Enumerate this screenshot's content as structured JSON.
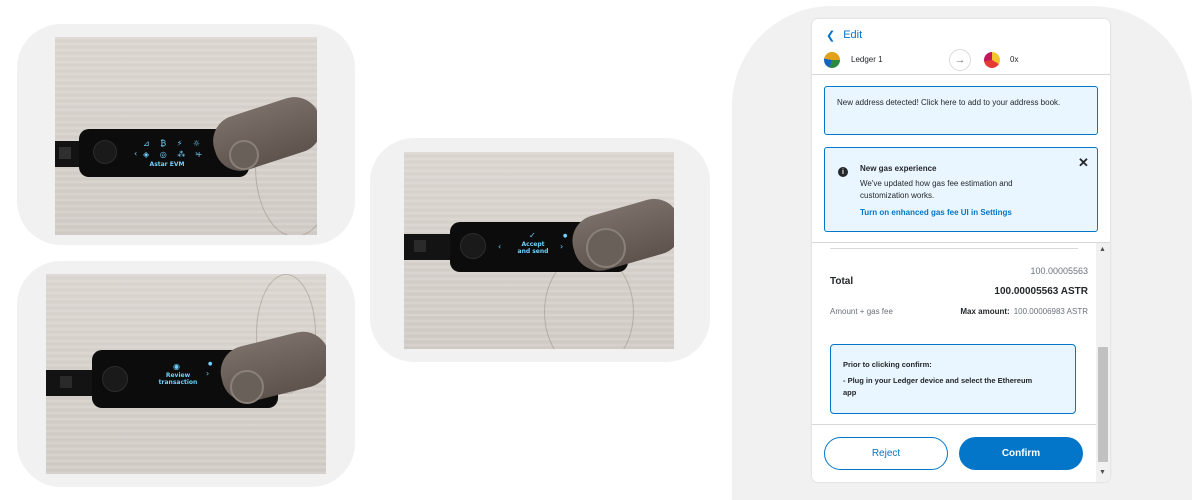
{
  "photos": [
    {
      "id": "photo-app-list",
      "screen_lines": [
        "Astar EVM"
      ]
    },
    {
      "id": "photo-review",
      "screen_lines": [
        "Review",
        "transaction"
      ]
    },
    {
      "id": "photo-accept",
      "screen_lines": [
        "Accept",
        "and send"
      ]
    }
  ],
  "wallet": {
    "edit_label": "Edit",
    "from_account": "Ledger 1",
    "to_account": "0x",
    "address_notice": "New address detected! Click here to add to your address book.",
    "gas_banner": {
      "title": "New gas experience",
      "body": "We've updated how gas fee estimation and customization works.",
      "link": "Turn on enhanced gas fee UI in Settings"
    },
    "total": {
      "label": "Total",
      "amount_small": "100.00005563",
      "amount_big": "100.00005563 ASTR",
      "gas_label": "Amount + gas fee",
      "max_label": "Max amount:",
      "max_value": "100.00006983 ASTR"
    },
    "prior_notice": {
      "title": "Prior to clicking confirm:",
      "line1": "- Plug in your Ledger device and select the Ethereum",
      "line2": "app"
    },
    "buttons": {
      "reject": "Reject",
      "confirm": "Confirm"
    }
  },
  "colors": {
    "accent": "#0376c9",
    "banner_bg": "#eaf6ff",
    "screen_text": "#6fd1ff"
  },
  "icons": [
    "chevron-left-icon",
    "arrow-right-icon",
    "info-icon",
    "close-icon",
    "scroll-up-icon",
    "scroll-down-icon",
    "checkmark-icon",
    "eye-icon"
  ]
}
